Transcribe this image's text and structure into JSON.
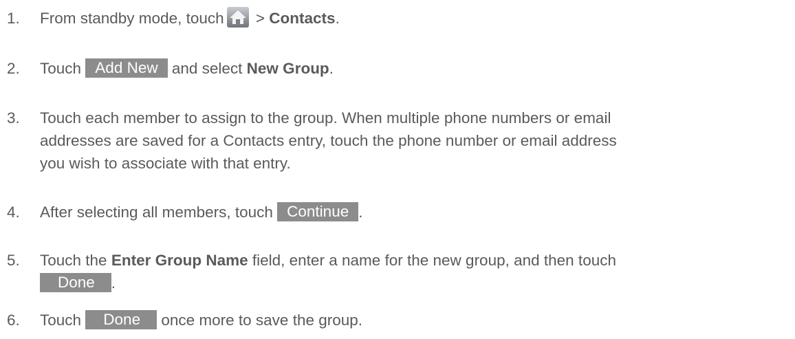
{
  "steps": [
    {
      "num": "1.",
      "pre": "From standby mode, touch",
      "icon": "home-icon",
      "sep": " > ",
      "bold": "Contacts",
      "post": "."
    },
    {
      "num": "2.",
      "pre": "Touch ",
      "button": "Add New",
      "mid": " and select ",
      "bold": "New Group",
      "post": "."
    },
    {
      "num": "3.",
      "lines": [
        "Touch each member to assign to the group. When multiple phone numbers or email",
        "addresses are saved for a Contacts entry, touch the phone number or email address",
        "you wish to associate with that entry."
      ]
    },
    {
      "num": "4.",
      "pre": "After selecting all members, touch ",
      "button": "Continue",
      "post": "."
    },
    {
      "num": "5.",
      "pre": "Touch the ",
      "bold": "Enter Group Name",
      "post": " field, enter a name for the new group, and then touch",
      "button": "Done",
      "end": "."
    },
    {
      "num": "6.",
      "pre": "Touch ",
      "button": "Done",
      "post": " once more to save the group."
    }
  ],
  "colors": {
    "text": "#5a5a5a",
    "button_bg": "#8c8c8c",
    "button_text": "#ffffff"
  }
}
